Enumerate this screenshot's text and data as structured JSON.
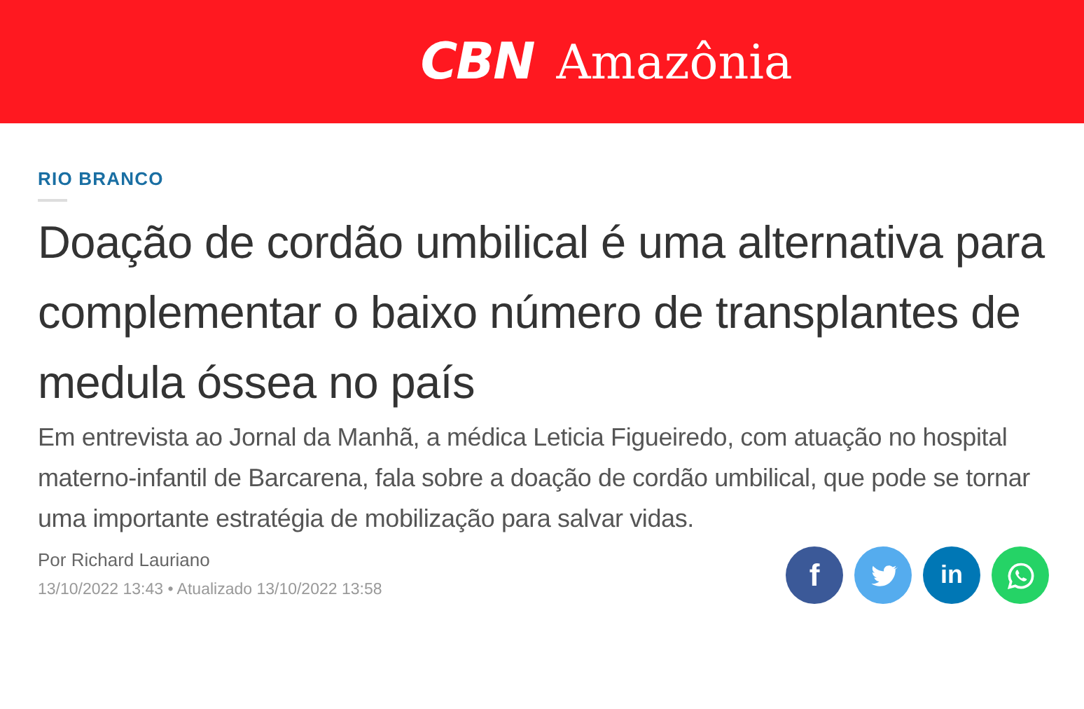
{
  "header": {
    "brand": "CBN",
    "region": "Amazônia"
  },
  "article": {
    "category": "RIO BRANCO",
    "title": "Doação de cordão umbilical é uma alternativa para complementar o baixo número de transplantes de medula óssea no país",
    "lead": "Em entrevista ao Jornal da Manhã, a médica Leticia Figueiredo, com atuação no hospital materno-infantil de Barcarena, fala sobre a doação de cordão umbilical, que pode se tornar uma importante estratégia de mobilização para salvar vidas.",
    "author": "Por Richard Lauriano",
    "dates": "13/10/2022 13:43 • Atualizado 13/10/2022 13:58"
  },
  "share_buttons": [
    {
      "kind": "facebook",
      "label": "f",
      "color": "#3b5998"
    },
    {
      "kind": "twitter",
      "color": "#55acee"
    },
    {
      "kind": "linkedin",
      "label": "in",
      "color": "#0077b5"
    },
    {
      "kind": "whatsapp",
      "color": "#25d366"
    }
  ]
}
